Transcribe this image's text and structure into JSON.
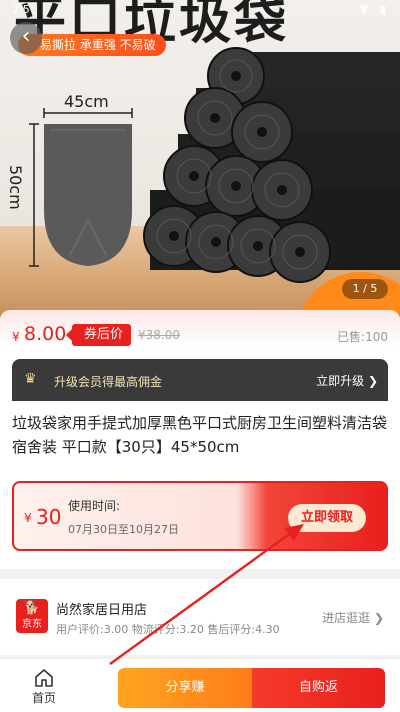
{
  "status_bar": {
    "time": "2:5",
    "icons": "▼ ▮"
  },
  "hero": {
    "title": "平口垃圾袋",
    "banner": "易撕拉  承重强  不易破",
    "dim_width": "45cm",
    "dim_height": "50cm",
    "page_indicator": "1 / 5",
    "icons": [
      "back-icon",
      "wifi-icon",
      "battery-icon"
    ]
  },
  "price": {
    "currency": "¥",
    "value": "8.00",
    "tag": "券后价",
    "original": "¥38.00",
    "sold": "已售:100"
  },
  "vip": {
    "text": "升级会员得最高佣金",
    "action": "立即升级 ❯"
  },
  "product": {
    "title": "垃圾袋家用手提式加厚黑色平口式厨房卫生间塑料清洁袋宿舍装 平口款【30只】45*50cm"
  },
  "coupon": {
    "currency": "¥",
    "value": "30",
    "time_label": "使用时间:",
    "time_range": "07月30日至10月27日",
    "button": "立即领取"
  },
  "shop": {
    "logo_text": "京东",
    "name": "尚然家居日用店",
    "scores": "用户评价:3.00  物流评分:3.20  售后评分:4.30",
    "visit": "进店逛逛 ❯"
  },
  "bottom_bar": {
    "home": "首页",
    "share": "分享赚",
    "buy": "自购返"
  },
  "colors": {
    "accent_red": "#e8201e",
    "accent_orange": "#ff8a1a",
    "vip_bg": "#3a3a3a"
  }
}
